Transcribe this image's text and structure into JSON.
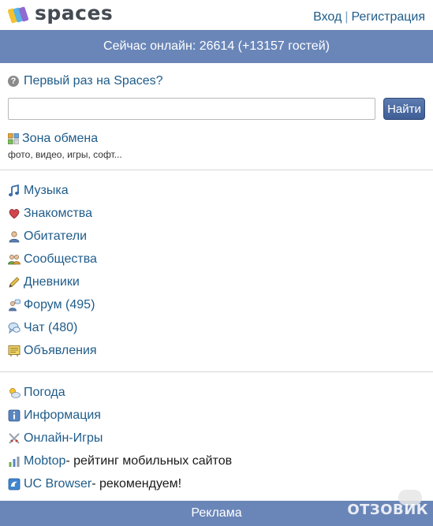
{
  "header": {
    "logo_text": "spaces",
    "login": "Вход",
    "separator": "|",
    "register": "Регистрация"
  },
  "online": {
    "text": "Сейчас онлайн: 26614 (+13157 гостей)"
  },
  "first_time": {
    "label": "Первый раз на Spaces?"
  },
  "search": {
    "value": "",
    "button": "Найти"
  },
  "exchange": {
    "title": "Зона обмена",
    "subtitle": "фото, видео, игры, софт..."
  },
  "menu_main": [
    {
      "icon": "music-note-icon",
      "label": "Музыка",
      "extra": ""
    },
    {
      "icon": "heart-icon",
      "label": "Знакомства",
      "extra": ""
    },
    {
      "icon": "person-icon",
      "label": "Обитатели",
      "extra": ""
    },
    {
      "icon": "group-icon",
      "label": "Сообщества",
      "extra": ""
    },
    {
      "icon": "pencil-icon",
      "label": "Дневники",
      "extra": ""
    },
    {
      "icon": "forum-icon",
      "label": "Форум (495)",
      "extra": ""
    },
    {
      "icon": "chat-icon",
      "label": "Чат (480)",
      "extra": ""
    },
    {
      "icon": "ads-icon",
      "label": "Объявления",
      "extra": ""
    }
  ],
  "menu_extra": [
    {
      "icon": "weather-icon",
      "label": "Погода",
      "extra": ""
    },
    {
      "icon": "info-icon",
      "label": "Информация",
      "extra": ""
    },
    {
      "icon": "swords-icon",
      "label": "Онлайн-Игры",
      "extra": ""
    },
    {
      "icon": "bar-chart-icon",
      "label": "Mobtop",
      "extra": " - рейтинг мобильных сайтов"
    },
    {
      "icon": "uc-browser-icon",
      "label": "UC Browser",
      "extra": " - рекомендуем!"
    }
  ],
  "footer": {
    "ads": "Реклама"
  },
  "watermark": {
    "text": "ОТЗОВИК"
  },
  "colors": {
    "bar": "#6a86b8",
    "link": "#1f5c8a",
    "button": "#4a6aa2"
  }
}
